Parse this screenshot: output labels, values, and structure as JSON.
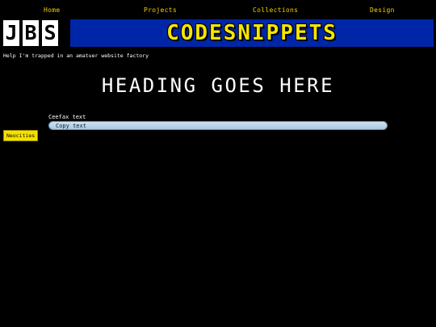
{
  "nav": {
    "items": [
      {
        "label": "Home"
      },
      {
        "label": "Projects"
      },
      {
        "label": "Collections"
      },
      {
        "label": "Design"
      }
    ]
  },
  "logo": {
    "letters": [
      "J",
      "B",
      "S"
    ]
  },
  "banner": {
    "title": "CODESNIPPETS"
  },
  "tagline": "Help I'm trapped in an amatuer website factory",
  "main": {
    "heading": "HEADING GOES HERE",
    "field_label": "Ceefax text",
    "field_value": "Copy text"
  },
  "badge": {
    "label": "Neocities"
  },
  "colors": {
    "background": "#000000",
    "nav_link": "#f5d000",
    "banner_bg": "#0026a8",
    "banner_text": "#f6e600",
    "badge_bg": "#f5e100"
  }
}
